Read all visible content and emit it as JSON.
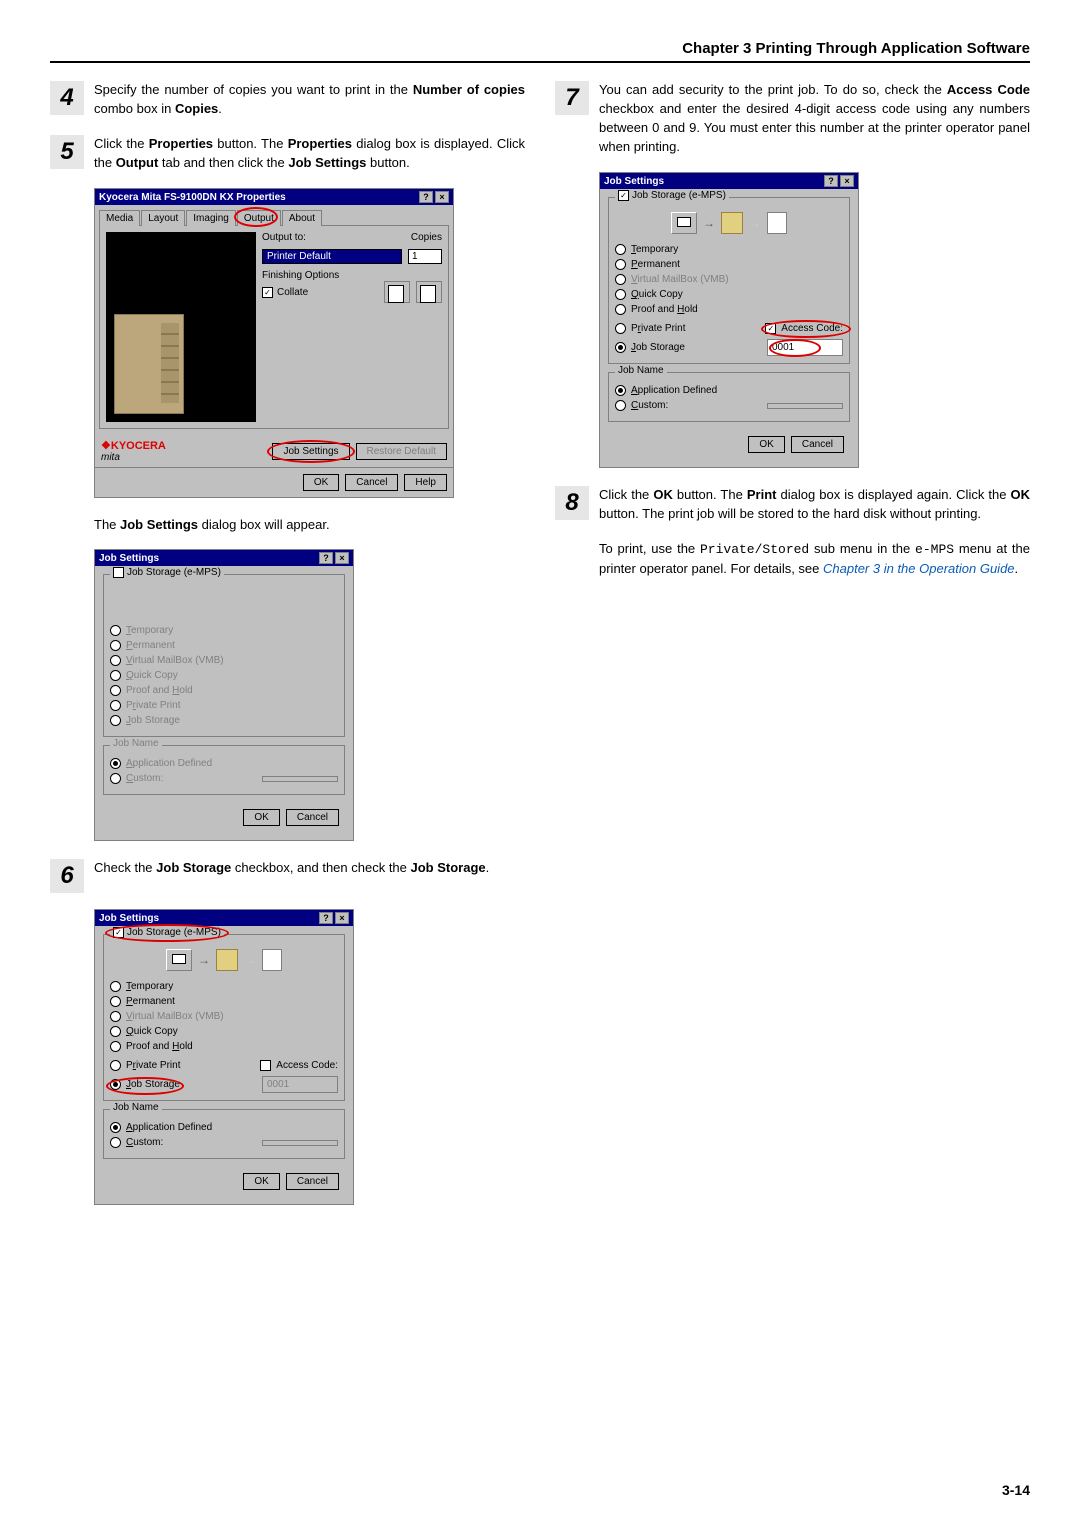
{
  "header": {
    "chapter": "Chapter 3  Printing Through Application Software"
  },
  "steps": {
    "4": {
      "text_parts": [
        "Specify the number of copies you want to print in the ",
        "Number of copies",
        " combo box in ",
        "Copies",
        "."
      ]
    },
    "5": {
      "text_parts": [
        "Click the ",
        "Properties",
        " button. The ",
        "Properties",
        " dialog box is displayed. Click the ",
        "Output",
        " tab and then click the ",
        "Job Settings",
        " button."
      ]
    },
    "5_after": "The Job Settings dialog box will appear.",
    "6": {
      "text_parts": [
        "Check the ",
        "Job Storage",
        " checkbox, and then check the ",
        "Job Storage",
        "."
      ]
    },
    "7": {
      "text_parts": [
        "You can add security to the print job. To do so, check the ",
        "Access Code",
        " checkbox and enter the desired 4-digit access code using any numbers between 0 and 9. You must enter this number at the printer operator panel when printing."
      ]
    },
    "8": {
      "text_parts": [
        "Click the ",
        "OK",
        " button. The ",
        "Print",
        " dialog box is displayed again. Click the ",
        "OK",
        " button. The print job will be stored to the hard disk without printing."
      ],
      "after1": "To print, use the ",
      "mono1": "Private/Stored",
      "after2": " sub menu in the ",
      "mono2": "e-MPS",
      "after3": " menu at the printer operator panel. For details, see ",
      "link": "Chapter 3 in the Operation Guide",
      "after4": "."
    }
  },
  "properties_dialog": {
    "title": "Kyocera Mita FS-9100DN KX Properties",
    "tabs": [
      "Media",
      "Layout",
      "Imaging",
      "Output",
      "About"
    ],
    "output_to_label": "Output to:",
    "output_to_value": "Printer Default",
    "copies_label": "Copies",
    "copies_value": "1",
    "finishing_label": "Finishing Options",
    "collate_label": "Collate",
    "logo": "KYOCERA",
    "logo_sub": "mita",
    "job_settings_btn": "Job Settings",
    "restore_btn": "Restore Default",
    "ok": "OK",
    "cancel": "Cancel",
    "help": "Help"
  },
  "job_settings_dialog": {
    "title": "Job Settings",
    "group_label": "Job Storage (e-MPS)",
    "options": [
      {
        "label": "Temporary",
        "key": "T"
      },
      {
        "label": "Permanent",
        "key": "P"
      },
      {
        "label": "Virtual MailBox (VMB)",
        "key": "V"
      },
      {
        "label": "Quick Copy",
        "key": "Q"
      },
      {
        "label": "Proof and Hold",
        "key": "H"
      },
      {
        "label": "Private Print",
        "key": "r"
      },
      {
        "label": "Job Storage",
        "key": "J"
      }
    ],
    "access_code_label": "Access Code:",
    "access_code_value": "0001",
    "job_name_label": "Job Name",
    "app_defined": "Application Defined",
    "custom": "Custom:",
    "ok": "OK",
    "cancel": "Cancel"
  },
  "page_number": "3-14"
}
